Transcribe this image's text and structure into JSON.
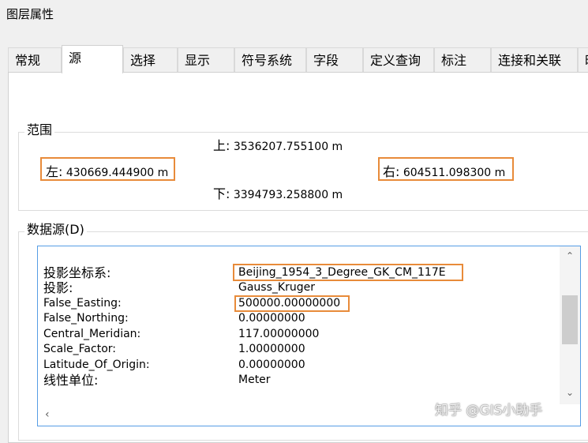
{
  "window": {
    "title": "图层属性"
  },
  "tabs": [
    {
      "label": "常规"
    },
    {
      "label": "源",
      "active": true
    },
    {
      "label": "选择"
    },
    {
      "label": "显示"
    },
    {
      "label": "符号系统"
    },
    {
      "label": "字段"
    },
    {
      "label": "定义查询"
    },
    {
      "label": "标注"
    },
    {
      "label": "连接和关联"
    },
    {
      "label": "时"
    }
  ],
  "extent": {
    "label": "范围",
    "top": {
      "caption": "上:",
      "value": "3536207.755100 m"
    },
    "left": {
      "caption": "左:",
      "value": "430669.444900 m"
    },
    "right": {
      "caption": "右:",
      "value": "604511.098300 m"
    },
    "bottom": {
      "caption": "下:",
      "value": "3394793.258800 m"
    }
  },
  "datasource": {
    "label": "数据源(D)",
    "rows": [
      {
        "key": "投影坐标系:",
        "value": "Beijing_1954_3_Degree_GK_CM_117E"
      },
      {
        "key": "投影:",
        "value": "Gauss_Kruger"
      },
      {
        "key": "False_Easting:",
        "value": "500000.00000000"
      },
      {
        "key": "False_Northing:",
        "value": "0.00000000"
      },
      {
        "key": "Central_Meridian:",
        "value": "117.00000000"
      },
      {
        "key": "Scale_Factor:",
        "value": "1.00000000"
      },
      {
        "key": "Latitude_Of_Origin:",
        "value": "0.00000000"
      },
      {
        "key": "线性单位:",
        "value": "Meter"
      }
    ],
    "scroll_position": 0.45
  },
  "watermark": {
    "text": "知乎 @GIS小助手"
  },
  "colors": {
    "highlight": "#e88b3a",
    "listbox_border": "#569de5",
    "window_bg": "#f0f0f0"
  },
  "icons": {
    "scroll_up": "chevron-up-icon",
    "scroll_down": "chevron-down-icon",
    "scroll_left": "chevron-left-icon"
  }
}
